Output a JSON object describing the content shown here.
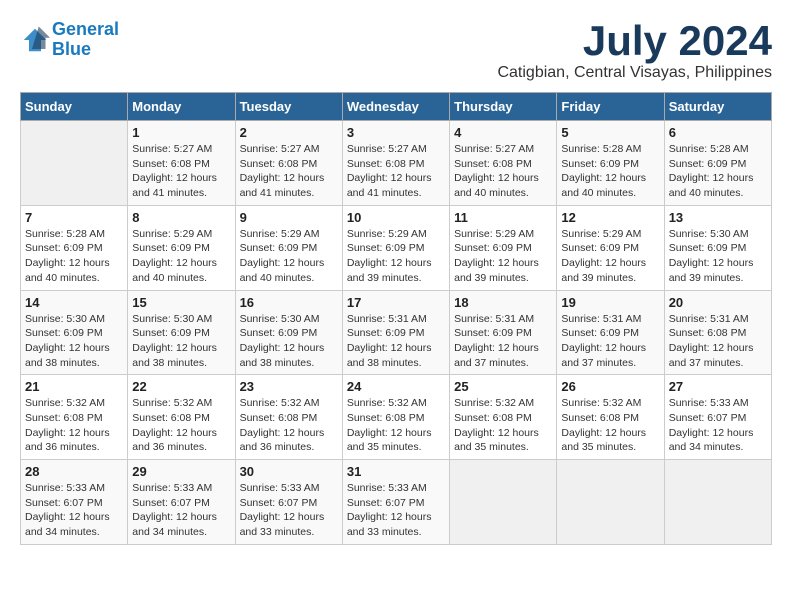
{
  "header": {
    "logo_line1": "General",
    "logo_line2": "Blue",
    "month_year": "July 2024",
    "location": "Catigbian, Central Visayas, Philippines"
  },
  "calendar": {
    "days_of_week": [
      "Sunday",
      "Monday",
      "Tuesday",
      "Wednesday",
      "Thursday",
      "Friday",
      "Saturday"
    ],
    "weeks": [
      [
        {
          "day": "",
          "info": ""
        },
        {
          "day": "1",
          "info": "Sunrise: 5:27 AM\nSunset: 6:08 PM\nDaylight: 12 hours\nand 41 minutes."
        },
        {
          "day": "2",
          "info": "Sunrise: 5:27 AM\nSunset: 6:08 PM\nDaylight: 12 hours\nand 41 minutes."
        },
        {
          "day": "3",
          "info": "Sunrise: 5:27 AM\nSunset: 6:08 PM\nDaylight: 12 hours\nand 41 minutes."
        },
        {
          "day": "4",
          "info": "Sunrise: 5:27 AM\nSunset: 6:08 PM\nDaylight: 12 hours\nand 40 minutes."
        },
        {
          "day": "5",
          "info": "Sunrise: 5:28 AM\nSunset: 6:09 PM\nDaylight: 12 hours\nand 40 minutes."
        },
        {
          "day": "6",
          "info": "Sunrise: 5:28 AM\nSunset: 6:09 PM\nDaylight: 12 hours\nand 40 minutes."
        }
      ],
      [
        {
          "day": "7",
          "info": "Sunrise: 5:28 AM\nSunset: 6:09 PM\nDaylight: 12 hours\nand 40 minutes."
        },
        {
          "day": "8",
          "info": "Sunrise: 5:29 AM\nSunset: 6:09 PM\nDaylight: 12 hours\nand 40 minutes."
        },
        {
          "day": "9",
          "info": "Sunrise: 5:29 AM\nSunset: 6:09 PM\nDaylight: 12 hours\nand 40 minutes."
        },
        {
          "day": "10",
          "info": "Sunrise: 5:29 AM\nSunset: 6:09 PM\nDaylight: 12 hours\nand 39 minutes."
        },
        {
          "day": "11",
          "info": "Sunrise: 5:29 AM\nSunset: 6:09 PM\nDaylight: 12 hours\nand 39 minutes."
        },
        {
          "day": "12",
          "info": "Sunrise: 5:29 AM\nSunset: 6:09 PM\nDaylight: 12 hours\nand 39 minutes."
        },
        {
          "day": "13",
          "info": "Sunrise: 5:30 AM\nSunset: 6:09 PM\nDaylight: 12 hours\nand 39 minutes."
        }
      ],
      [
        {
          "day": "14",
          "info": "Sunrise: 5:30 AM\nSunset: 6:09 PM\nDaylight: 12 hours\nand 38 minutes."
        },
        {
          "day": "15",
          "info": "Sunrise: 5:30 AM\nSunset: 6:09 PM\nDaylight: 12 hours\nand 38 minutes."
        },
        {
          "day": "16",
          "info": "Sunrise: 5:30 AM\nSunset: 6:09 PM\nDaylight: 12 hours\nand 38 minutes."
        },
        {
          "day": "17",
          "info": "Sunrise: 5:31 AM\nSunset: 6:09 PM\nDaylight: 12 hours\nand 38 minutes."
        },
        {
          "day": "18",
          "info": "Sunrise: 5:31 AM\nSunset: 6:09 PM\nDaylight: 12 hours\nand 37 minutes."
        },
        {
          "day": "19",
          "info": "Sunrise: 5:31 AM\nSunset: 6:09 PM\nDaylight: 12 hours\nand 37 minutes."
        },
        {
          "day": "20",
          "info": "Sunrise: 5:31 AM\nSunset: 6:08 PM\nDaylight: 12 hours\nand 37 minutes."
        }
      ],
      [
        {
          "day": "21",
          "info": "Sunrise: 5:32 AM\nSunset: 6:08 PM\nDaylight: 12 hours\nand 36 minutes."
        },
        {
          "day": "22",
          "info": "Sunrise: 5:32 AM\nSunset: 6:08 PM\nDaylight: 12 hours\nand 36 minutes."
        },
        {
          "day": "23",
          "info": "Sunrise: 5:32 AM\nSunset: 6:08 PM\nDaylight: 12 hours\nand 36 minutes."
        },
        {
          "day": "24",
          "info": "Sunrise: 5:32 AM\nSunset: 6:08 PM\nDaylight: 12 hours\nand 35 minutes."
        },
        {
          "day": "25",
          "info": "Sunrise: 5:32 AM\nSunset: 6:08 PM\nDaylight: 12 hours\nand 35 minutes."
        },
        {
          "day": "26",
          "info": "Sunrise: 5:32 AM\nSunset: 6:08 PM\nDaylight: 12 hours\nand 35 minutes."
        },
        {
          "day": "27",
          "info": "Sunrise: 5:33 AM\nSunset: 6:07 PM\nDaylight: 12 hours\nand 34 minutes."
        }
      ],
      [
        {
          "day": "28",
          "info": "Sunrise: 5:33 AM\nSunset: 6:07 PM\nDaylight: 12 hours\nand 34 minutes."
        },
        {
          "day": "29",
          "info": "Sunrise: 5:33 AM\nSunset: 6:07 PM\nDaylight: 12 hours\nand 34 minutes."
        },
        {
          "day": "30",
          "info": "Sunrise: 5:33 AM\nSunset: 6:07 PM\nDaylight: 12 hours\nand 33 minutes."
        },
        {
          "day": "31",
          "info": "Sunrise: 5:33 AM\nSunset: 6:07 PM\nDaylight: 12 hours\nand 33 minutes."
        },
        {
          "day": "",
          "info": ""
        },
        {
          "day": "",
          "info": ""
        },
        {
          "day": "",
          "info": ""
        }
      ]
    ]
  }
}
